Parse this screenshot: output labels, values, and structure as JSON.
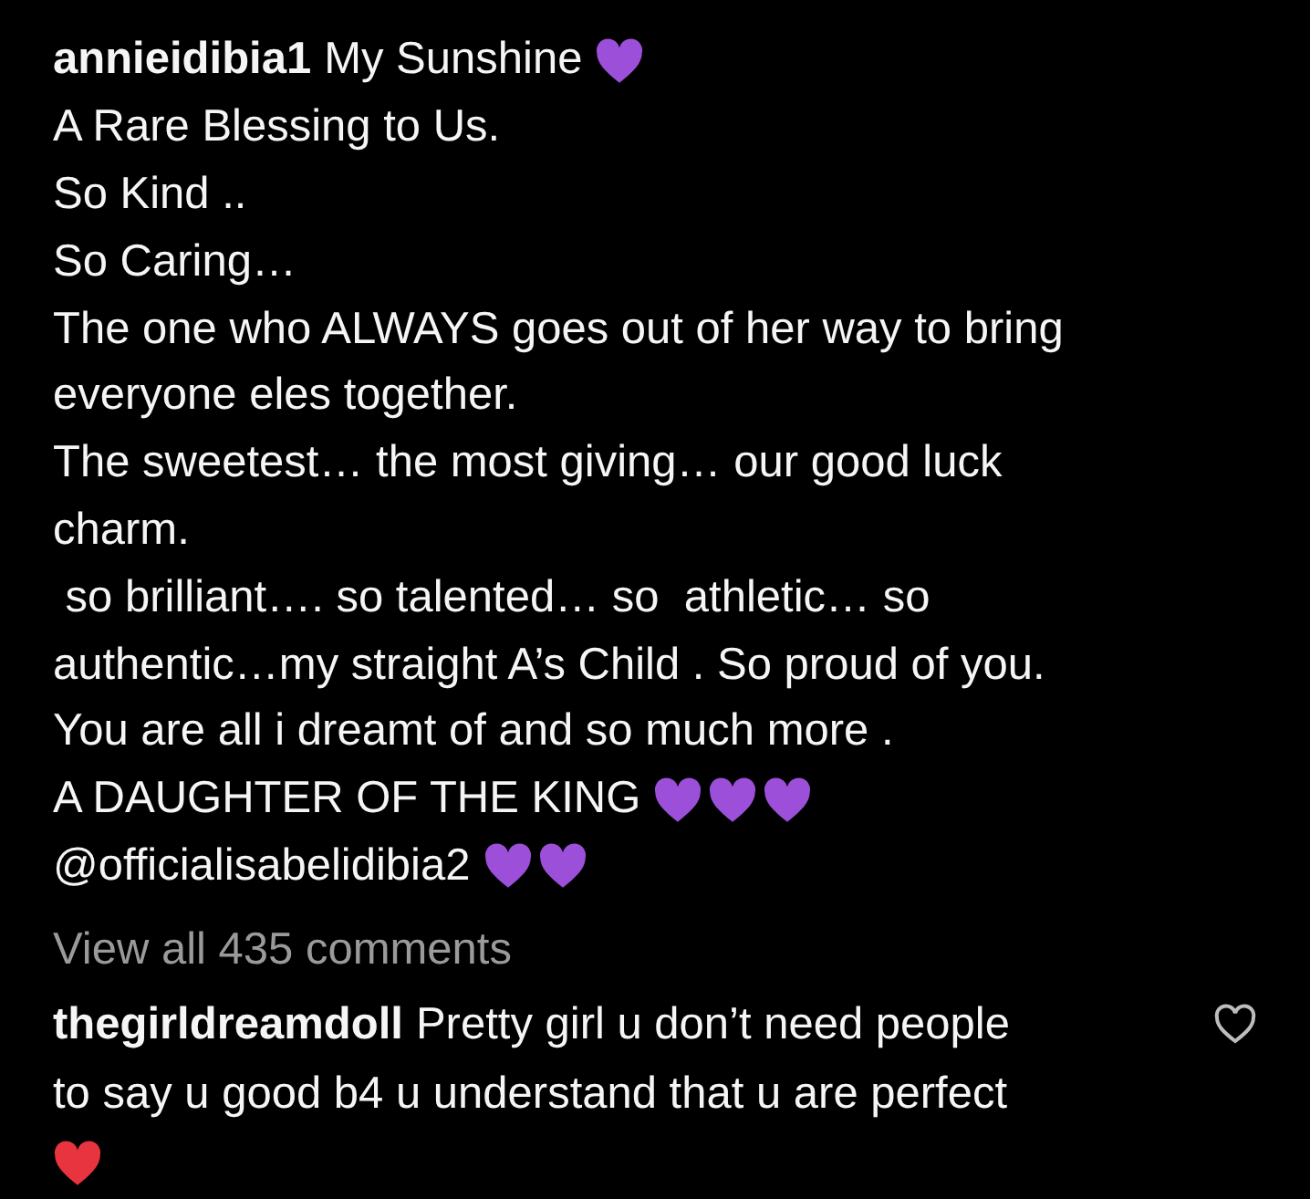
{
  "caption": {
    "username": "annieidibia1",
    "lines": [
      {
        "text": "My Sunshine",
        "hearts": [
          {
            "color": "#9c4fd8"
          }
        ]
      },
      {
        "text": "A Rare Blessing to Us."
      },
      {
        "text": "So Kind .."
      },
      {
        "text": "So Caring…"
      },
      {
        "text": "The one who ALWAYS goes out of her way to bring"
      },
      {
        "text": "everyone eles together."
      },
      {
        "text": "The sweetest… the most giving… our good luck"
      },
      {
        "text": "charm."
      },
      {
        "text": " so brilliant…. so talented… so  athletic… so"
      },
      {
        "text": "authentic…my straight A’s Child . So proud of you."
      },
      {
        "text": "You are all i dreamt of and so much more ."
      },
      {
        "text": "A DAUGHTER OF THE KING",
        "hearts": [
          {
            "color": "#9c4fd8"
          },
          {
            "color": "#9c4fd8"
          },
          {
            "color": "#9c4fd8"
          }
        ]
      },
      {
        "text": "@officialisabelidibia2",
        "hearts": [
          {
            "color": "#9c4fd8"
          },
          {
            "color": "#9c4fd8"
          }
        ]
      }
    ]
  },
  "view_all": "View all 435 comments",
  "comment": {
    "username": "thegirldreamdoll",
    "lines": [
      {
        "text": "Pretty girl u don’t need people"
      },
      {
        "text": "to say u good b4 u understand that u are perfect"
      },
      {
        "hearts": [
          {
            "color": "#e8343f"
          }
        ]
      }
    ],
    "liked": false
  }
}
